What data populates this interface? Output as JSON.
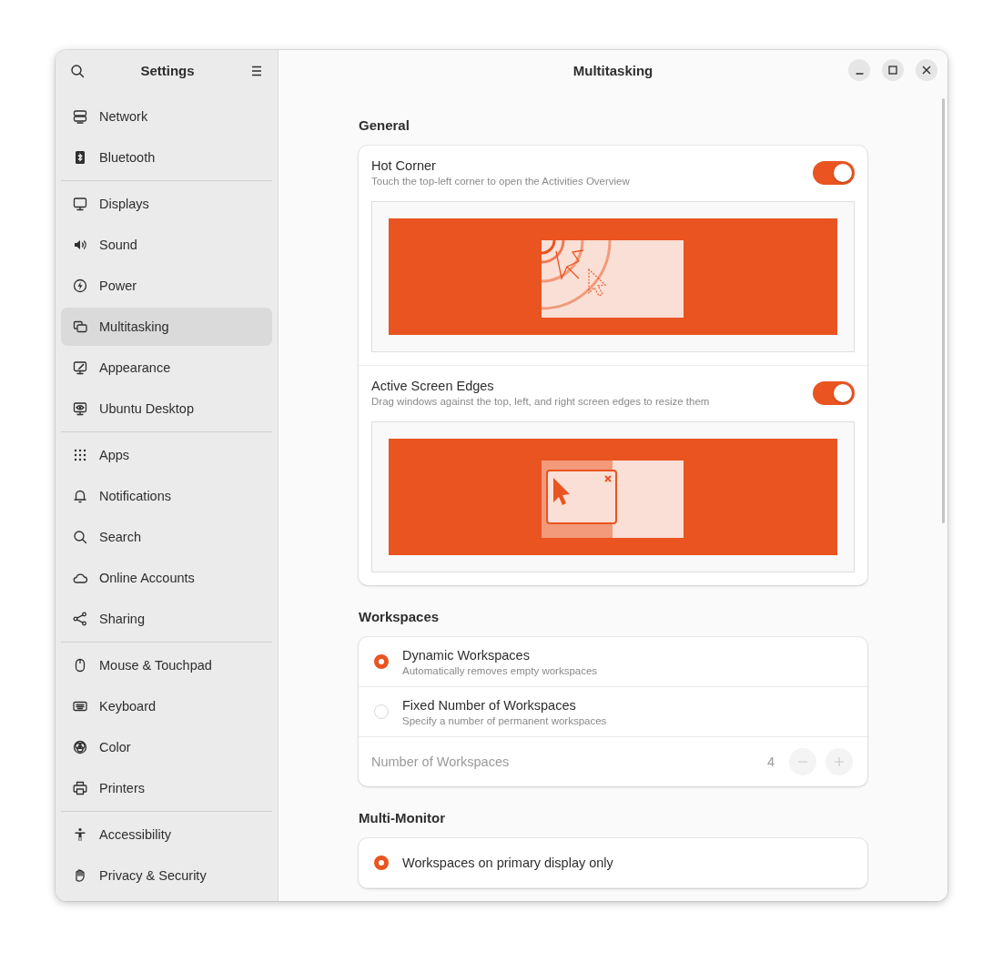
{
  "sidebar": {
    "title": "Settings",
    "groups": [
      [
        {
          "label": "Network",
          "selected": false
        },
        {
          "label": "Bluetooth",
          "selected": false
        }
      ],
      [
        {
          "label": "Displays",
          "selected": false
        },
        {
          "label": "Sound",
          "selected": false
        },
        {
          "label": "Power",
          "selected": false
        },
        {
          "label": "Multitasking",
          "selected": true
        },
        {
          "label": "Appearance",
          "selected": false
        },
        {
          "label": "Ubuntu Desktop",
          "selected": false
        }
      ],
      [
        {
          "label": "Apps",
          "selected": false
        },
        {
          "label": "Notifications",
          "selected": false
        },
        {
          "label": "Search",
          "selected": false
        },
        {
          "label": "Online Accounts",
          "selected": false
        },
        {
          "label": "Sharing",
          "selected": false
        }
      ],
      [
        {
          "label": "Mouse & Touchpad",
          "selected": false
        },
        {
          "label": "Keyboard",
          "selected": false
        },
        {
          "label": "Color",
          "selected": false
        },
        {
          "label": "Printers",
          "selected": false
        }
      ],
      [
        {
          "label": "Accessibility",
          "selected": false
        },
        {
          "label": "Privacy & Security",
          "selected": false
        }
      ]
    ]
  },
  "header": {
    "title": "Multitasking"
  },
  "sections": [
    {
      "heading": "General",
      "rows": [
        {
          "kind": "toggle",
          "title": "Hot Corner",
          "subtitle": "Touch the top-left corner to open the Activities Overview",
          "on": true
        },
        {
          "kind": "toggle",
          "title": "Active Screen Edges",
          "subtitle": "Drag windows against the top, left, and right screen edges to resize them",
          "on": true
        }
      ]
    },
    {
      "heading": "Workspaces",
      "rows": [
        {
          "kind": "radio",
          "title": "Dynamic Workspaces",
          "subtitle": "Automatically removes empty workspaces",
          "selected": true
        },
        {
          "kind": "radio",
          "title": "Fixed Number of Workspaces",
          "subtitle": "Specify a number of permanent workspaces",
          "selected": false
        },
        {
          "kind": "spin",
          "title": "Number of Workspaces",
          "value": "4",
          "disabled": true
        }
      ]
    },
    {
      "heading": "Multi-Monitor",
      "rows": [
        {
          "kind": "radio",
          "title": "Workspaces on primary display only",
          "selected": true
        }
      ]
    }
  ]
}
